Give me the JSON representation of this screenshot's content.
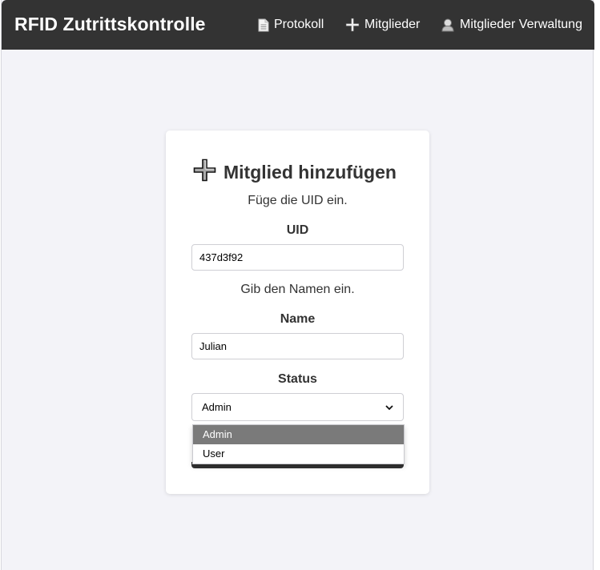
{
  "header": {
    "brand": "RFID Zutrittskontrolle",
    "nav": [
      {
        "label": "Protokoll",
        "icon": "document-icon"
      },
      {
        "label": "Mitglieder",
        "icon": "plus-icon"
      },
      {
        "label": "Mitglieder Verwaltung",
        "icon": "user-icon"
      }
    ]
  },
  "form": {
    "title": "Mitglied hinzufügen",
    "uid_hint": "Füge die UID ein.",
    "uid_label": "UID",
    "uid_value": "437d3f92",
    "name_hint": "Gib den Namen ein.",
    "name_label": "Name",
    "name_value": "Julian",
    "status_label": "Status",
    "status_value": "Admin",
    "status_options": [
      "Admin",
      "User"
    ]
  },
  "colors": {
    "header_bg": "#333333",
    "page_bg": "#f3f3f8",
    "option_highlight": "#7a7a7a"
  }
}
